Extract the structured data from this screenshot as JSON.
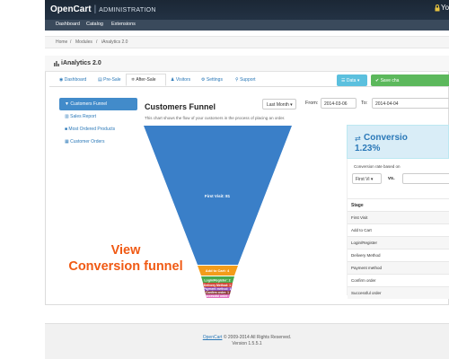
{
  "header": {
    "brand": "OpenCart",
    "separator": "|",
    "subtitle": "ADMINISTRATION",
    "user_fragment": "Yo"
  },
  "topnav": {
    "items": [
      "Dashboard",
      "Catalog",
      "Extensions"
    ]
  },
  "breadcrumb": {
    "items": [
      "Home",
      "Modules",
      "iAnalytics 2.0"
    ],
    "separator": "/"
  },
  "panel": {
    "title": "iAnalytics 2.0",
    "tabs": [
      "Dashboard",
      "Pre-Sale",
      "After-Sale",
      "Visitors",
      "Settings",
      "Support"
    ],
    "active_tab": "After-Sale",
    "data_button": "Data",
    "save_button": "Save cha"
  },
  "sidebar": {
    "items": [
      "Customers Funnel",
      "Sales Report",
      "Most Ordered Products",
      "Customer Orders"
    ],
    "active": "Customers Funnel"
  },
  "funnel": {
    "title": "Customers Funnel",
    "description": "This chart shows the flow of your customers in the process of placing an order.",
    "range": "Last Month",
    "from_label": "From:",
    "from_date": "2014-03-06",
    "to_label": "To:",
    "to_date": "2014-04-04",
    "stages": [
      {
        "label": "First Visit: 81",
        "color": "#3a7fc8"
      },
      {
        "label": "Add to Cart: 4",
        "color": "#f39c1a"
      },
      {
        "label": "Login/Register: 2",
        "color": "#4aa84a"
      },
      {
        "label": "Delivery Method: 1",
        "color": "#d14a3a"
      },
      {
        "label": "Payment method: 1",
        "color": "#8a4ab8"
      },
      {
        "label": "Confirm order: 1",
        "color": "#8a3a3a"
      },
      {
        "label": "Successful order: 1",
        "color": "#e070c0"
      }
    ]
  },
  "promo": {
    "line1": "View",
    "line2": "Conversion funnel"
  },
  "conversion": {
    "title": "Conversio",
    "value": "1.23%",
    "note": "Conversion rate based on",
    "select_value": "First Vi",
    "vs": "vs.",
    "stage_header": "Stage",
    "stages": [
      "First Visit",
      "Add to Cart",
      "Login/Register",
      "Delivery Method",
      "Payment method",
      "Confirm order",
      "Successful order"
    ]
  },
  "footer": {
    "link": "OpenCart",
    "copyright": "© 2009-2014 All Rights Reserved.",
    "version": "Version 1.5.5.1"
  },
  "colors": {
    "header_bg": "#1b2735",
    "link": "#2a78b8",
    "active_sidebar": "#428bca",
    "promo": "#f05a14",
    "save_button": "#5cb85c",
    "data_button": "#5bc0de"
  }
}
